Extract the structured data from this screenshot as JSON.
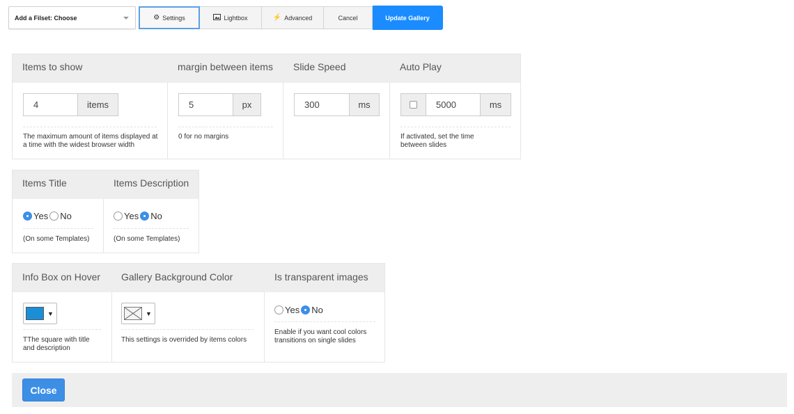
{
  "toolbar": {
    "fileset_label": "Add a Filset: Choose",
    "settings": "Settings",
    "lightbox": "Lightbox",
    "advanced": "Advanced",
    "cancel": "Cancel",
    "update": "Update Gallery"
  },
  "panel1": {
    "headers": [
      "Items to show",
      "margin between items",
      "Slide Speed",
      "Auto Play"
    ],
    "items_value": "4",
    "items_unit": "items",
    "items_help": "The maximum amount of items displayed at a time with the widest browser width",
    "margin_value": "5",
    "margin_unit": "px",
    "margin_help": "0 for no margins",
    "speed_value": "300",
    "speed_unit": "ms",
    "autoplay_checked": false,
    "autoplay_value": "5000",
    "autoplay_unit": "ms",
    "autoplay_help": "If activated, set the time between slides"
  },
  "panel2": {
    "headers": [
      "Items Title",
      "Items Description"
    ],
    "title_yes": "Yes",
    "title_no": "No",
    "title_selected": "Yes",
    "title_help": "(On some Templates)",
    "desc_yes": "Yes",
    "desc_no": "No",
    "desc_selected": "No",
    "desc_help": "(On some Templates)"
  },
  "panel3": {
    "headers": [
      "Info Box on Hover",
      "Gallery Background Color",
      "Is transparent images"
    ],
    "infobox_color": "#1a8fd6",
    "infobox_help": "TThe square with title and description",
    "bg_help": "This settings is overrided by items colors",
    "transparent_yes": "Yes",
    "transparent_no": "No",
    "transparent_selected": "No",
    "transparent_help": "Enable if you want cool colors transitions on single slides"
  },
  "footer": {
    "close": "Close"
  },
  "colors": {
    "primary": "#1a8cff",
    "radio_on": "#3d8fe6",
    "header_bg": "#eeeeee"
  }
}
